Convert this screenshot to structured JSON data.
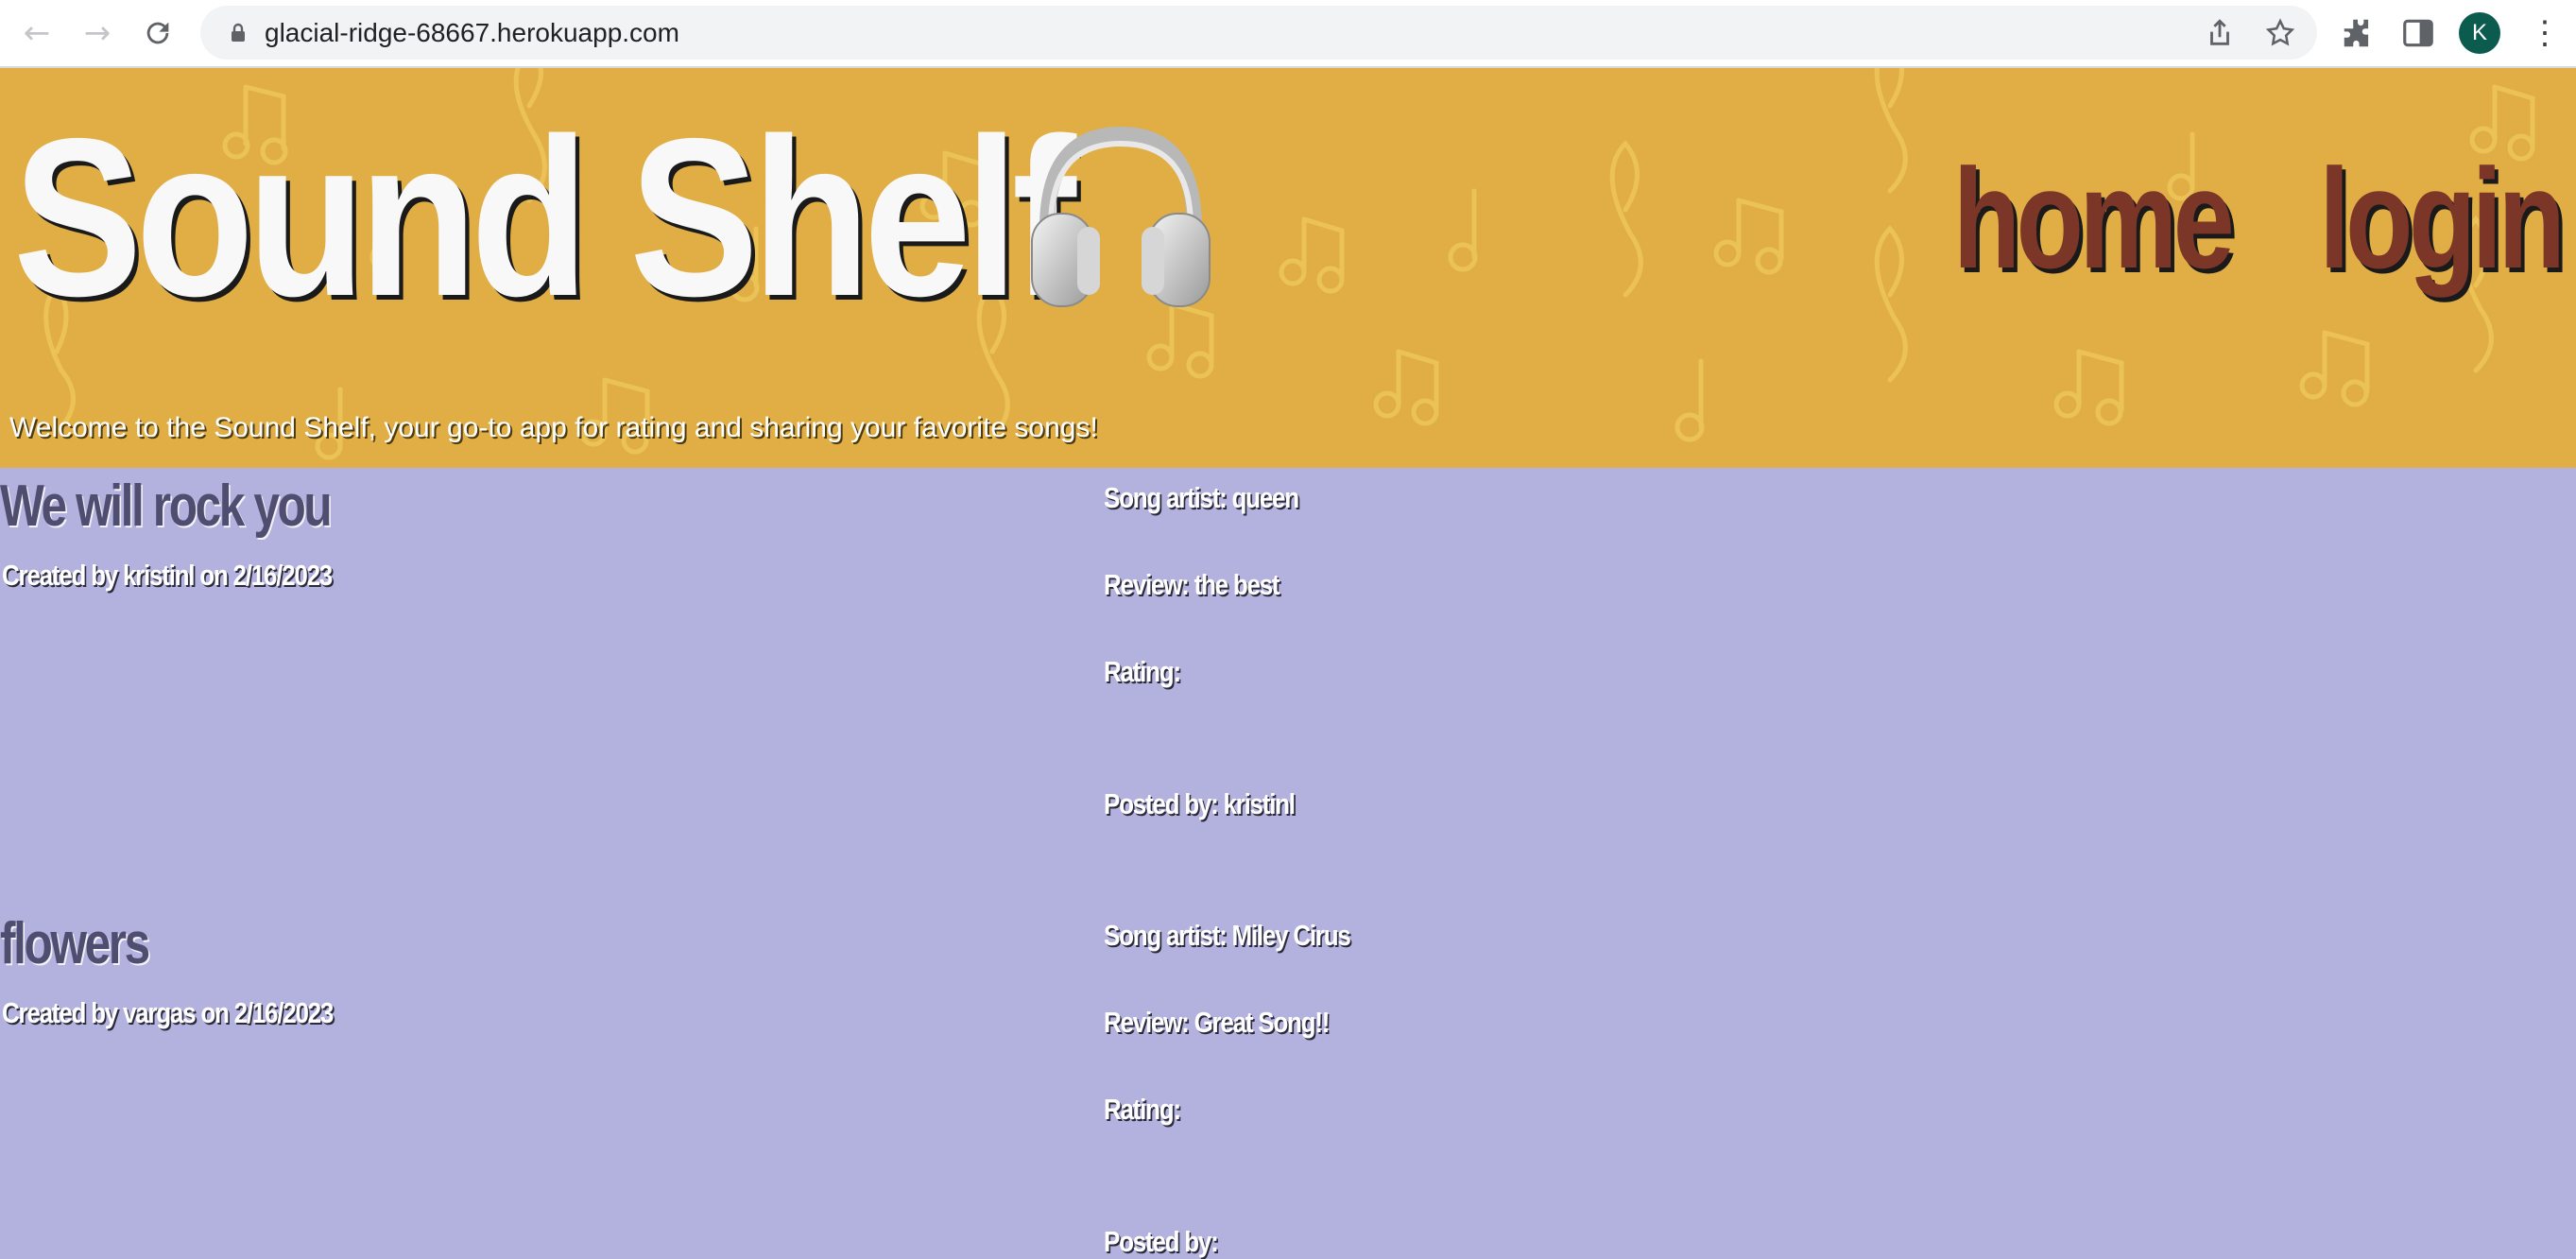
{
  "browser": {
    "url": "glacial-ridge-68667.herokuapp.com",
    "profile_initial": "K",
    "icons": {
      "back": "back-arrow-icon",
      "forward": "forward-arrow-icon",
      "reload": "reload-icon",
      "lock": "lock-icon",
      "share": "share-icon",
      "bookmark": "star-icon",
      "extensions": "puzzle-icon",
      "side_panel": "side-panel-icon",
      "menu": "kebab-menu-icon"
    }
  },
  "header": {
    "title": "Sound Shelf",
    "title_icon": "headphones-icon",
    "nav": [
      {
        "label": "home"
      },
      {
        "label": "login"
      }
    ],
    "welcome": "Welcome to the Sound Shelf, your go-to app for rating and sharing your favorite songs!"
  },
  "posts": [
    {
      "title": "We will rock you",
      "created": "Created by kristinl on 2/16/2023",
      "artist": "Song artist: queen",
      "review": "Review: the best",
      "rating": "Rating:",
      "posted_by": "Posted by: kristinl"
    },
    {
      "title": "flowers",
      "created": "Created by vargas on 2/16/2023",
      "artist": "Song artist: Miley Cirus",
      "review": "Review: Great Song!!",
      "rating": "Rating:",
      "posted_by": "Posted by: "
    }
  ],
  "colors": {
    "header_bg": "#e0ae45",
    "page_bg": "#b3b1de",
    "nav_link": "#7b3628",
    "post_title": "#4f4e70"
  }
}
